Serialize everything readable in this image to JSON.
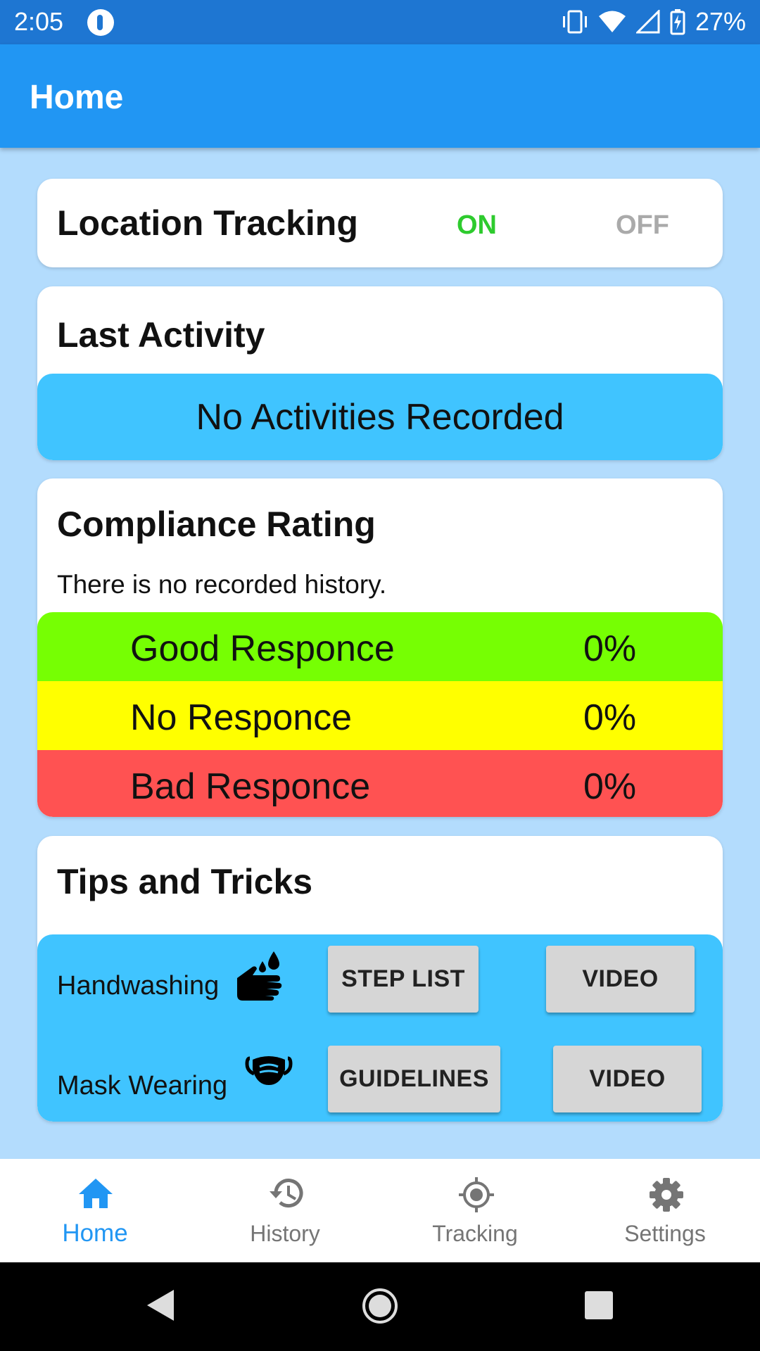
{
  "status_bar": {
    "time": "2:05",
    "battery": "27%"
  },
  "app_bar": {
    "title": "Home"
  },
  "location_tracking": {
    "title": "Location Tracking",
    "on_label": "ON",
    "off_label": "OFF",
    "state": "on"
  },
  "last_activity": {
    "title": "Last Activity",
    "message": "No Activities Recorded"
  },
  "compliance": {
    "title": "Compliance Rating",
    "note": "There is no recorded history.",
    "rows": [
      {
        "label": "Good Responce",
        "value": "0%",
        "color": "#76ff03"
      },
      {
        "label": "No Responce",
        "value": "0%",
        "color": "#ffff00"
      },
      {
        "label": "Bad Responce",
        "value": "0%",
        "color": "#ff5252"
      }
    ]
  },
  "tips": {
    "title": "Tips and Tricks",
    "items": [
      {
        "label": "Handwashing",
        "icon": "handwashing-icon",
        "buttons": [
          "STEP LIST",
          "VIDEO"
        ]
      },
      {
        "label": "Mask Wearing",
        "icon": "mask-icon",
        "buttons": [
          "GUIDELINES",
          "VIDEO"
        ]
      }
    ]
  },
  "bottom_nav": {
    "items": [
      {
        "label": "Home",
        "icon": "home-icon",
        "active": true
      },
      {
        "label": "History",
        "icon": "history-icon",
        "active": false
      },
      {
        "label": "Tracking",
        "icon": "tracking-icon",
        "active": false
      },
      {
        "label": "Settings",
        "icon": "gear-icon",
        "active": false
      }
    ]
  },
  "colors": {
    "primary": "#2196f3",
    "status_bar": "#1e76d2",
    "background": "#b3dcfd",
    "accent_panel": "#40c4ff",
    "on_green": "#2ecb2e"
  }
}
